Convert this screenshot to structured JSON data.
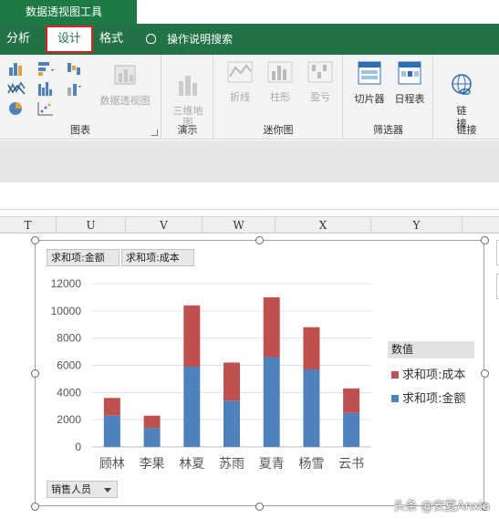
{
  "app": {
    "tool_title": "数据透视图工具",
    "tabs": [
      {
        "label": "分析"
      },
      {
        "label": "设计",
        "active": true
      },
      {
        "label": "格式"
      }
    ],
    "tell_me": "操作说明搜索"
  },
  "ribbon": {
    "groups": [
      {
        "label": "图表",
        "big_button": "数据透视图",
        "big_button_enabled": false
      },
      {
        "label": "演示",
        "big_button": "三维地\n图",
        "big_button_enabled": false
      },
      {
        "label": "迷你图",
        "buttons": [
          "折线",
          "柱形",
          "盈亏"
        ],
        "enabled": false
      },
      {
        "label": "筛选器",
        "buttons": [
          "切片器",
          "日程表"
        ],
        "enabled": true
      },
      {
        "label": "链接",
        "buttons": [
          "链\n接"
        ],
        "enabled": true
      }
    ]
  },
  "sheet": {
    "columns": [
      "T",
      "U",
      "V",
      "W",
      "X",
      "Y"
    ]
  },
  "pivot_chart": {
    "value_field_buttons": [
      "求和项:金额",
      "求和项:成本"
    ],
    "axis_field_button": "销售人员",
    "legend_title": "数值",
    "legend": [
      {
        "name": "求和项:成本",
        "color": "#c0504d"
      },
      {
        "name": "求和项:金额",
        "color": "#4f81bd"
      }
    ]
  },
  "chart_data": {
    "type": "bar",
    "stacked": true,
    "categories": [
      "顾林",
      "李果",
      "林夏",
      "苏雨",
      "夏青",
      "杨雪",
      "云书"
    ],
    "series": [
      {
        "name": "求和项:金额",
        "color": "#4f81bd",
        "values": [
          2300,
          1400,
          5900,
          3400,
          6600,
          5700,
          2500
        ]
      },
      {
        "name": "求和项:成本",
        "color": "#c0504d",
        "values": [
          1300,
          900,
          4500,
          2800,
          4400,
          3100,
          1800
        ]
      }
    ],
    "y_ticks": [
      "0",
      "2000",
      "4000",
      "6000",
      "8000",
      "10000",
      "12000"
    ],
    "ylim": [
      0,
      12000
    ],
    "grid": true,
    "legend_position": "right"
  },
  "watermark": "头条 @安夏Anxia"
}
